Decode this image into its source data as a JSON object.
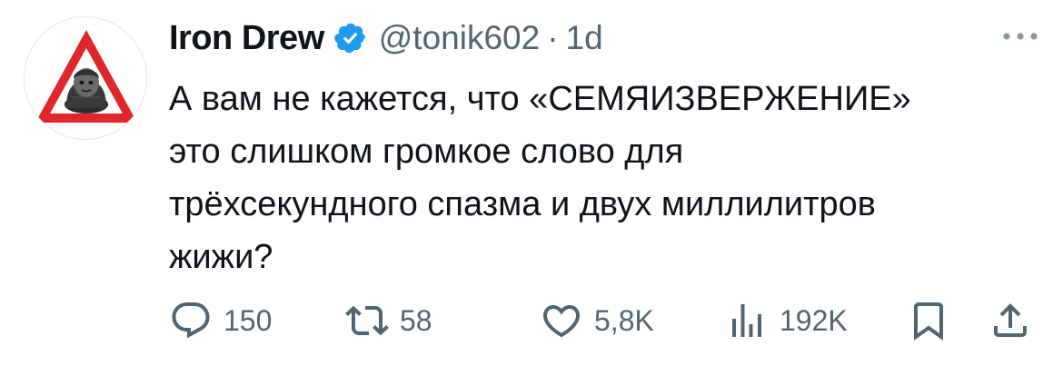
{
  "tweet": {
    "author": {
      "name": "Iron Drew",
      "handle": "@tonik602",
      "verified": true
    },
    "separator": "·",
    "time": "1d",
    "text": "А вам не кажется, что «СЕМЯИЗВЕРЖЕНИЕ»\nэто слишком громкое слово для\nтрёхсекундного спазма и двух миллилитров\nжижи?",
    "stats": {
      "replies": "150",
      "reposts": "58",
      "likes": "5,8K",
      "views": "192K"
    }
  },
  "icons": {
    "avatar": "warning-sign-avatar",
    "verified": "verified-badge-icon",
    "more": "more-dots-icon",
    "reply": "reply-icon",
    "repost": "repost-icon",
    "like": "heart-icon",
    "views": "views-bar-chart-icon",
    "bookmark": "bookmark-icon",
    "share": "share-icon"
  },
  "colors": {
    "text": "#0f1419",
    "secondary": "#536471",
    "verified_blue": "#1d9bf0",
    "avatar_red": "#e0262b"
  }
}
